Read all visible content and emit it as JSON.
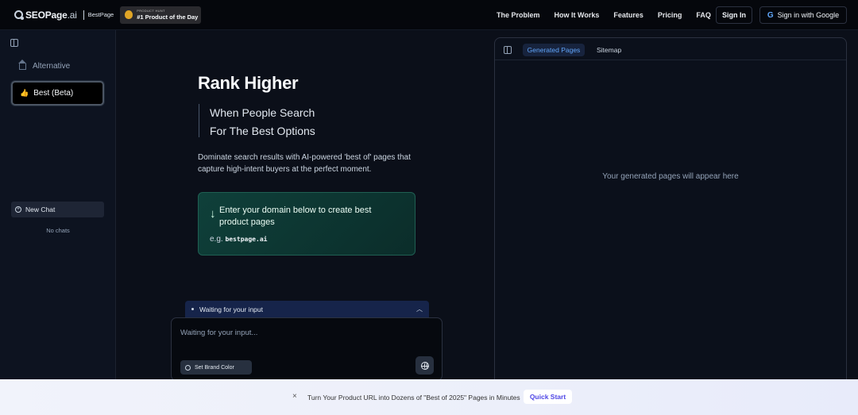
{
  "brand": {
    "logo_name": "SEOPage",
    "logo_suffix": ".ai",
    "sub_brand": "BestPage",
    "badge_small": "PRODUCT HUNT",
    "badge_big": "#1 Product of the Day"
  },
  "nav": {
    "links": [
      "The Problem",
      "How It Works",
      "Features",
      "Pricing",
      "FAQ"
    ],
    "sign_in": "Sign In",
    "google_sign_in": "Sign in with Google",
    "google_icon": "G"
  },
  "sidebar": {
    "items": [
      {
        "label": "Alternative",
        "icon": "home-icon"
      },
      {
        "label": "Best (Beta)",
        "icon": "thumbs-up-icon",
        "active": true
      }
    ],
    "new_chat": "New Chat",
    "empty_text": "No chats"
  },
  "hero": {
    "title": "Rank Higher",
    "subtitle_line1": "When People Search",
    "subtitle_line2": "For The Best Options",
    "description": "Dominate search results with AI-powered 'best of' pages that capture high-intent buyers at the perfect moment."
  },
  "domain_card": {
    "text": "Enter your domain below to create best product pages",
    "example_prefix": "e.g.",
    "example_domain": "bestpage.ai"
  },
  "chat": {
    "status": "Waiting for your input",
    "placeholder": "Waiting for your input...",
    "brand_color_button": "Set Brand Color"
  },
  "right_panel": {
    "tabs": [
      {
        "label": "Generated Pages",
        "active": true
      },
      {
        "label": "Sitemap",
        "active": false
      }
    ],
    "empty_text": "Your generated pages will appear here"
  },
  "banner": {
    "text": "Turn Your Product URL into Dozens of \"Best of 2025\" Pages in Minutes",
    "cta": "Quick Start",
    "close": "×"
  },
  "colors": {
    "background": "#0b0f19",
    "accent": "#60a5fa",
    "card_green": "#0f403a",
    "cta_text": "#4f46e5"
  }
}
